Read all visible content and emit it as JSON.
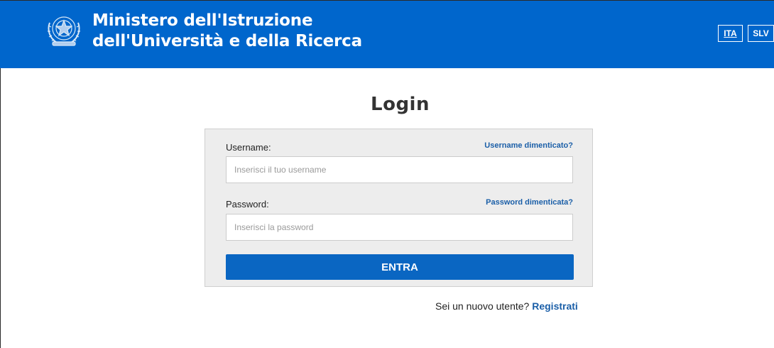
{
  "header": {
    "title_line1": "Ministero dell'Istruzione",
    "title_line2": "dell'Università e della Ricerca",
    "background": "#0066cc",
    "emblem_icon": "italian-republic-emblem-icon",
    "languages": [
      "ITA",
      "SLV"
    ],
    "active_language": "ITA"
  },
  "page": {
    "title": "Login"
  },
  "form": {
    "username_label": "Username:",
    "username_forgot": "Username dimenticato?",
    "username_placeholder": "Inserisci il tuo username",
    "password_label": "Password:",
    "password_forgot": "Password dimenticata?",
    "password_placeholder": "Inserisci la password",
    "submit_label": "ENTRA",
    "button_color": "#0a66c2",
    "link_color": "#1b5fa8"
  },
  "footer": {
    "new_user_text": "Sei un nuovo utente?",
    "register_link": "Registrati"
  }
}
